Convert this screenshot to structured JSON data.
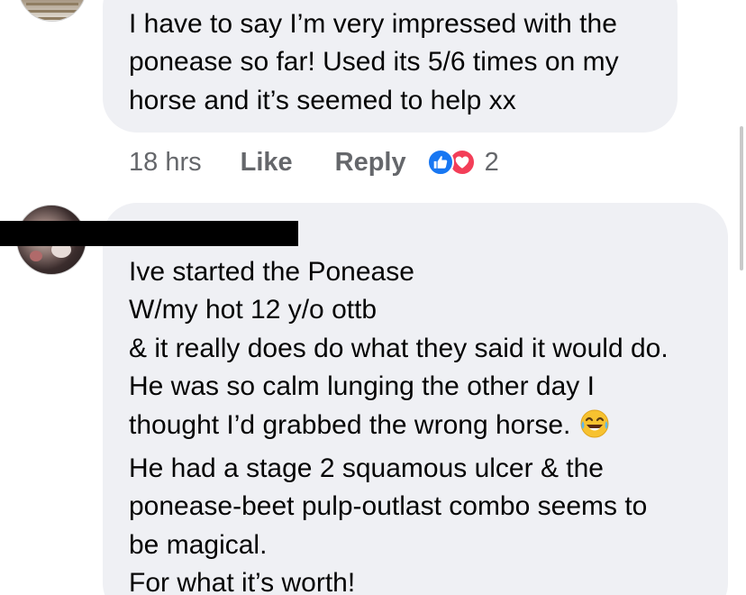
{
  "comments": [
    {
      "text_lines": [
        "I have to say I’m very impressed with the",
        "ponease so far! Used its 5/6 times on my",
        "horse and it’s seemed to help xx"
      ],
      "timestamp": "18 hrs",
      "like_label": "Like",
      "reply_label": "Reply",
      "reaction_icons": [
        "like-reaction-icon",
        "love-reaction-icon"
      ],
      "reaction_count": "2"
    },
    {
      "text_lines": [
        "Ive started the Ponease",
        "W/my hot 12 y/o ottb",
        "& it really does do what they said it would do.",
        "He was so calm lunging the other day I",
        "thought I’d grabbed the wrong horse.",
        "He had a stage 2 squamous ulcer & the",
        "ponease-beet pulp-outlast combo seems to",
        "be magical.",
        "For what it’s worth!"
      ],
      "emoji": "face-with-tears-of-joy-icon"
    }
  ],
  "colors": {
    "bubble": "#eff0f4",
    "meta_text": "#65676b",
    "like_blue": "#1877f2",
    "love_red": "#f33e58"
  }
}
